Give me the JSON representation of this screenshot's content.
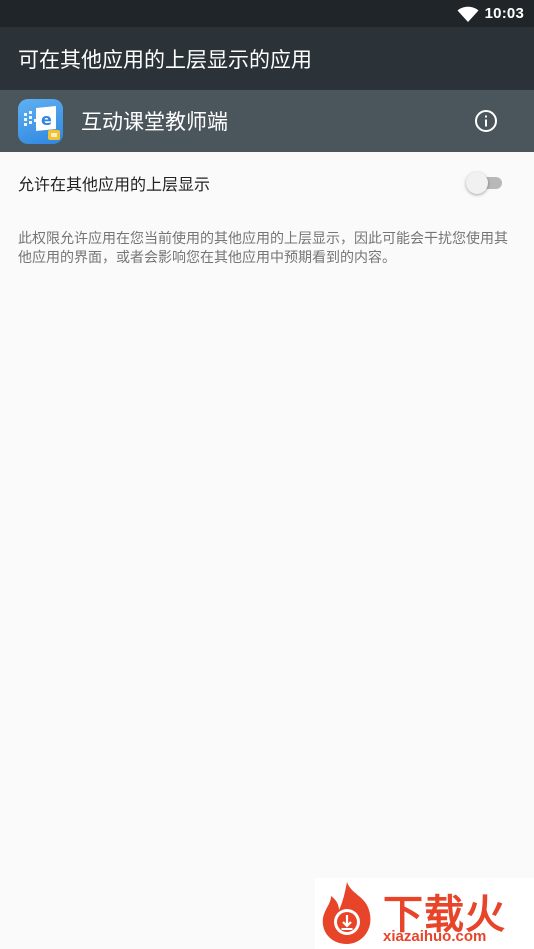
{
  "status_bar": {
    "time": "10:03",
    "wifi_icon": "wifi-icon"
  },
  "action_bar": {
    "title": "可在其他应用的上层显示的应用"
  },
  "app_header": {
    "app_name": "互动课堂教师端",
    "info_icon": "info-icon"
  },
  "permission": {
    "label": "允许在其他应用的上层显示",
    "enabled": false,
    "description": "此权限允许应用在您当前使用的其他应用的上层显示，因此可能会干扰您使用其他应用的界面，或者会影响您在其他应用中预期看到的内容。"
  },
  "watermark": {
    "name": "下载火",
    "domain": "xiazaihuo.com"
  },
  "colors": {
    "status_bar": "#1f2529",
    "action_bar": "#2b3338",
    "app_header": "#4b565c",
    "background": "#fafafa",
    "watermark": "#e8442a"
  }
}
